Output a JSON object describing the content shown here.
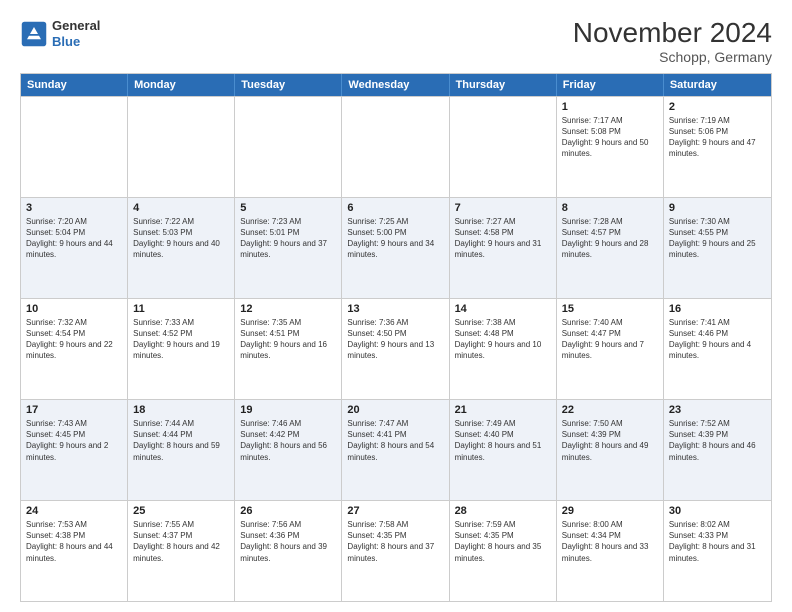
{
  "logo": {
    "general": "General",
    "blue": "Blue"
  },
  "title": "November 2024",
  "location": "Schopp, Germany",
  "days": [
    "Sunday",
    "Monday",
    "Tuesday",
    "Wednesday",
    "Thursday",
    "Friday",
    "Saturday"
  ],
  "rows": [
    [
      {
        "day": "",
        "sunrise": "",
        "sunset": "",
        "daylight": ""
      },
      {
        "day": "",
        "sunrise": "",
        "sunset": "",
        "daylight": ""
      },
      {
        "day": "",
        "sunrise": "",
        "sunset": "",
        "daylight": ""
      },
      {
        "day": "",
        "sunrise": "",
        "sunset": "",
        "daylight": ""
      },
      {
        "day": "",
        "sunrise": "",
        "sunset": "",
        "daylight": ""
      },
      {
        "day": "1",
        "sunrise": "Sunrise: 7:17 AM",
        "sunset": "Sunset: 5:08 PM",
        "daylight": "Daylight: 9 hours and 50 minutes."
      },
      {
        "day": "2",
        "sunrise": "Sunrise: 7:19 AM",
        "sunset": "Sunset: 5:06 PM",
        "daylight": "Daylight: 9 hours and 47 minutes."
      }
    ],
    [
      {
        "day": "3",
        "sunrise": "Sunrise: 7:20 AM",
        "sunset": "Sunset: 5:04 PM",
        "daylight": "Daylight: 9 hours and 44 minutes."
      },
      {
        "day": "4",
        "sunrise": "Sunrise: 7:22 AM",
        "sunset": "Sunset: 5:03 PM",
        "daylight": "Daylight: 9 hours and 40 minutes."
      },
      {
        "day": "5",
        "sunrise": "Sunrise: 7:23 AM",
        "sunset": "Sunset: 5:01 PM",
        "daylight": "Daylight: 9 hours and 37 minutes."
      },
      {
        "day": "6",
        "sunrise": "Sunrise: 7:25 AM",
        "sunset": "Sunset: 5:00 PM",
        "daylight": "Daylight: 9 hours and 34 minutes."
      },
      {
        "day": "7",
        "sunrise": "Sunrise: 7:27 AM",
        "sunset": "Sunset: 4:58 PM",
        "daylight": "Daylight: 9 hours and 31 minutes."
      },
      {
        "day": "8",
        "sunrise": "Sunrise: 7:28 AM",
        "sunset": "Sunset: 4:57 PM",
        "daylight": "Daylight: 9 hours and 28 minutes."
      },
      {
        "day": "9",
        "sunrise": "Sunrise: 7:30 AM",
        "sunset": "Sunset: 4:55 PM",
        "daylight": "Daylight: 9 hours and 25 minutes."
      }
    ],
    [
      {
        "day": "10",
        "sunrise": "Sunrise: 7:32 AM",
        "sunset": "Sunset: 4:54 PM",
        "daylight": "Daylight: 9 hours and 22 minutes."
      },
      {
        "day": "11",
        "sunrise": "Sunrise: 7:33 AM",
        "sunset": "Sunset: 4:52 PM",
        "daylight": "Daylight: 9 hours and 19 minutes."
      },
      {
        "day": "12",
        "sunrise": "Sunrise: 7:35 AM",
        "sunset": "Sunset: 4:51 PM",
        "daylight": "Daylight: 9 hours and 16 minutes."
      },
      {
        "day": "13",
        "sunrise": "Sunrise: 7:36 AM",
        "sunset": "Sunset: 4:50 PM",
        "daylight": "Daylight: 9 hours and 13 minutes."
      },
      {
        "day": "14",
        "sunrise": "Sunrise: 7:38 AM",
        "sunset": "Sunset: 4:48 PM",
        "daylight": "Daylight: 9 hours and 10 minutes."
      },
      {
        "day": "15",
        "sunrise": "Sunrise: 7:40 AM",
        "sunset": "Sunset: 4:47 PM",
        "daylight": "Daylight: 9 hours and 7 minutes."
      },
      {
        "day": "16",
        "sunrise": "Sunrise: 7:41 AM",
        "sunset": "Sunset: 4:46 PM",
        "daylight": "Daylight: 9 hours and 4 minutes."
      }
    ],
    [
      {
        "day": "17",
        "sunrise": "Sunrise: 7:43 AM",
        "sunset": "Sunset: 4:45 PM",
        "daylight": "Daylight: 9 hours and 2 minutes."
      },
      {
        "day": "18",
        "sunrise": "Sunrise: 7:44 AM",
        "sunset": "Sunset: 4:44 PM",
        "daylight": "Daylight: 8 hours and 59 minutes."
      },
      {
        "day": "19",
        "sunrise": "Sunrise: 7:46 AM",
        "sunset": "Sunset: 4:42 PM",
        "daylight": "Daylight: 8 hours and 56 minutes."
      },
      {
        "day": "20",
        "sunrise": "Sunrise: 7:47 AM",
        "sunset": "Sunset: 4:41 PM",
        "daylight": "Daylight: 8 hours and 54 minutes."
      },
      {
        "day": "21",
        "sunrise": "Sunrise: 7:49 AM",
        "sunset": "Sunset: 4:40 PM",
        "daylight": "Daylight: 8 hours and 51 minutes."
      },
      {
        "day": "22",
        "sunrise": "Sunrise: 7:50 AM",
        "sunset": "Sunset: 4:39 PM",
        "daylight": "Daylight: 8 hours and 49 minutes."
      },
      {
        "day": "23",
        "sunrise": "Sunrise: 7:52 AM",
        "sunset": "Sunset: 4:39 PM",
        "daylight": "Daylight: 8 hours and 46 minutes."
      }
    ],
    [
      {
        "day": "24",
        "sunrise": "Sunrise: 7:53 AM",
        "sunset": "Sunset: 4:38 PM",
        "daylight": "Daylight: 8 hours and 44 minutes."
      },
      {
        "day": "25",
        "sunrise": "Sunrise: 7:55 AM",
        "sunset": "Sunset: 4:37 PM",
        "daylight": "Daylight: 8 hours and 42 minutes."
      },
      {
        "day": "26",
        "sunrise": "Sunrise: 7:56 AM",
        "sunset": "Sunset: 4:36 PM",
        "daylight": "Daylight: 8 hours and 39 minutes."
      },
      {
        "day": "27",
        "sunrise": "Sunrise: 7:58 AM",
        "sunset": "Sunset: 4:35 PM",
        "daylight": "Daylight: 8 hours and 37 minutes."
      },
      {
        "day": "28",
        "sunrise": "Sunrise: 7:59 AM",
        "sunset": "Sunset: 4:35 PM",
        "daylight": "Daylight: 8 hours and 35 minutes."
      },
      {
        "day": "29",
        "sunrise": "Sunrise: 8:00 AM",
        "sunset": "Sunset: 4:34 PM",
        "daylight": "Daylight: 8 hours and 33 minutes."
      },
      {
        "day": "30",
        "sunrise": "Sunrise: 8:02 AM",
        "sunset": "Sunset: 4:33 PM",
        "daylight": "Daylight: 8 hours and 31 minutes."
      }
    ]
  ]
}
